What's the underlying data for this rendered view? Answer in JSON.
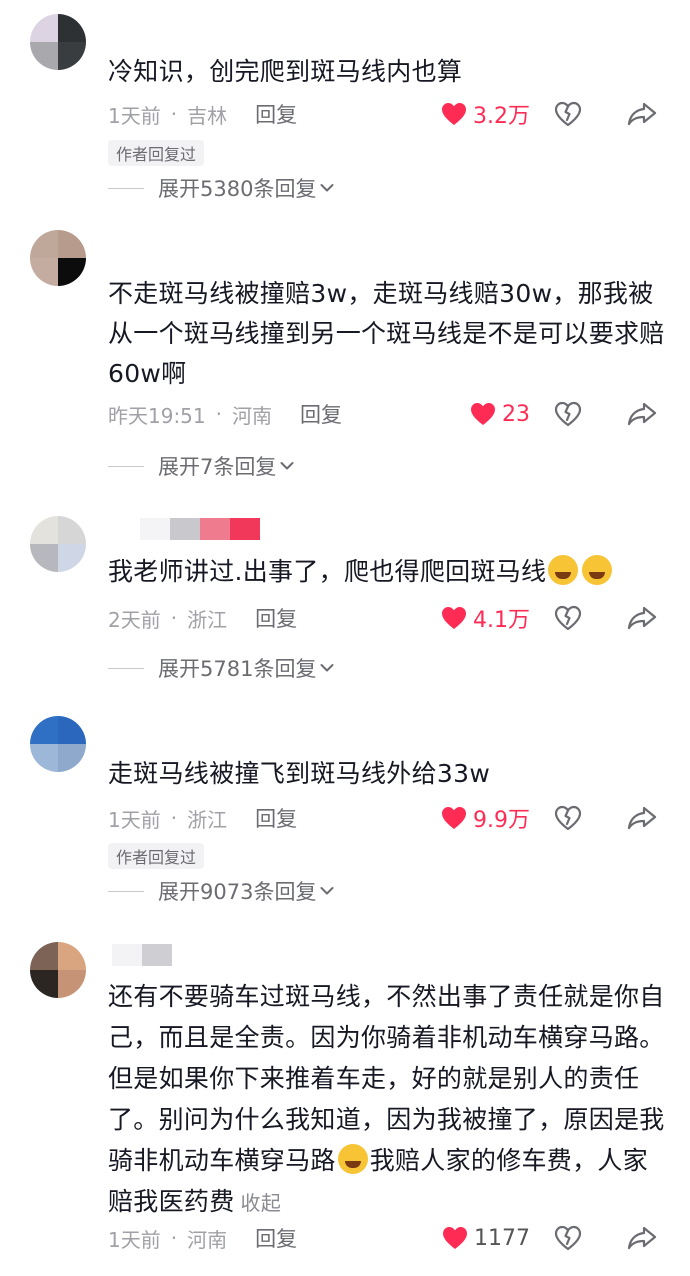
{
  "comments": [
    {
      "text": "冷知识，创完爬到斑马线内也算",
      "time": "1天前",
      "location": "吉林",
      "reply_label": "回复",
      "likes": "3.2万",
      "author_badge": "作者回复过",
      "expand_label": "展开5380条回复"
    },
    {
      "text": "不走斑马线被撞赔3w，走斑马线赔30w，那我被从一个斑马线撞到另一个斑马线是不是可以要求赔60w啊",
      "time": "昨天19:51",
      "location": "河南",
      "reply_label": "回复",
      "likes": "23",
      "expand_label": "展开7条回复"
    },
    {
      "text": "我老师讲过.出事了，爬也得爬回斑马线",
      "time": "2天前",
      "location": "浙江",
      "reply_label": "回复",
      "likes": "4.1万",
      "expand_label": "展开5781条回复"
    },
    {
      "text": "走斑马线被撞飞到斑马线外给33w",
      "time": "1天前",
      "location": "浙江",
      "reply_label": "回复",
      "likes": "9.9万",
      "author_badge": "作者回复过",
      "expand_label": "展开9073条回复"
    },
    {
      "text_part1": "还有不要骑车过斑马线，不然出事了责任就是你自己，而且是全责。因为你骑着非机动车横穿马路。但是如果你下来推着车走，好的就是别人的责任了。别问为什么我知道，因为我被撞了，原因是我骑非机动车横穿马路",
      "text_part2": "我赔人家的修车费，人家赔我医药费",
      "collapse_label": "收起",
      "time": "1天前",
      "location": "河南",
      "reply_label": "回复",
      "likes": "1177"
    }
  ],
  "separator": "·",
  "colors": {
    "like": "#fe2c55",
    "meta": "#a0a1a7",
    "text": "#161823"
  },
  "icons": [
    "heart-icon",
    "dislike-heart-icon",
    "share-arrow-icon",
    "chevron-down-icon",
    "emoji-icon"
  ]
}
